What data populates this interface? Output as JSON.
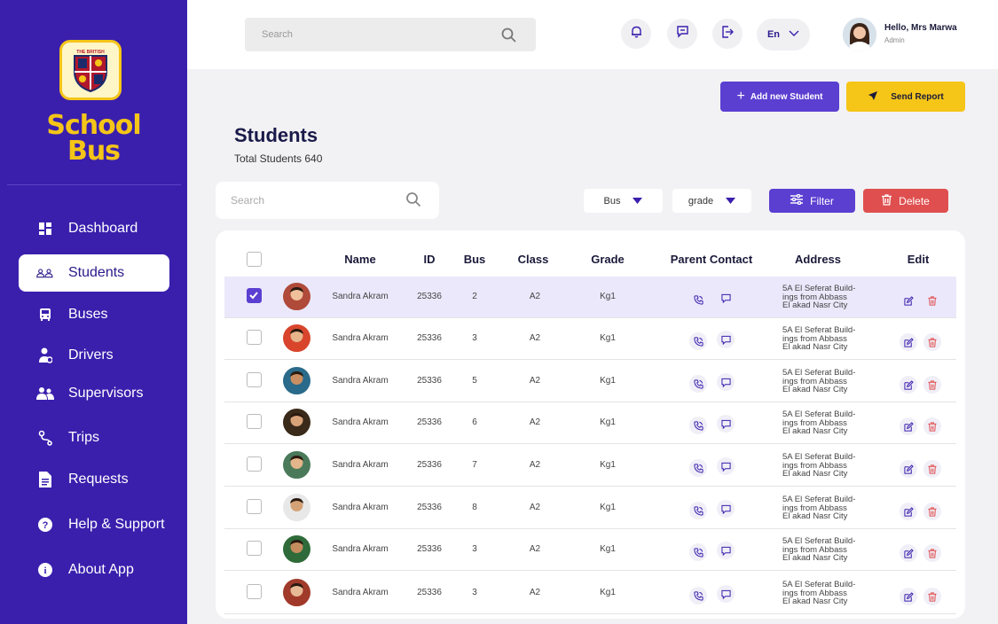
{
  "brand": {
    "line1": "School",
    "line2": "Bus",
    "badge_text": "THE BRITISH"
  },
  "nav": [
    {
      "label": "Dashboard",
      "icon": "dashboard-icon"
    },
    {
      "label": "Students",
      "icon": "students-icon",
      "active": true
    },
    {
      "label": "Buses",
      "icon": "bus-icon"
    },
    {
      "label": "Drivers",
      "icon": "driver-icon"
    },
    {
      "label": "Supervisors",
      "icon": "supervisors-icon"
    },
    {
      "label": "Trips",
      "icon": "trips-icon"
    },
    {
      "label": "Requests",
      "icon": "document-icon"
    },
    {
      "label": "Help & Support",
      "icon": "help-icon"
    },
    {
      "label": "About App",
      "icon": "info-icon"
    }
  ],
  "topbar": {
    "search_placeholder": "Search",
    "language": "En",
    "greeting": "Hello, Mrs Marwa",
    "role": "Admin"
  },
  "actions": {
    "add_student": "Add new Student",
    "send_report": "Send Report"
  },
  "page": {
    "title": "Students",
    "subtitle": "Total Students 640"
  },
  "toolbar": {
    "search_placeholder": "Search",
    "bus_select": "Bus",
    "grade_select": "grade",
    "filter": "Filter",
    "delete": "Delete"
  },
  "table": {
    "headers": {
      "name": "Name",
      "id": "ID",
      "bus": "Bus",
      "class": "Class",
      "grade": "Grade",
      "parent_contact": "Parent Contact",
      "address": "Address",
      "edit": "Edit"
    },
    "rows": [
      {
        "name": "Sandra Akram",
        "id": "25336",
        "bus": "2",
        "class": "A2",
        "grade": "Kg1",
        "address": [
          "5A El Seferat Build-",
          "ings from Abbass",
          "El akad Nasr City"
        ],
        "checked": true
      },
      {
        "name": "Sandra Akram",
        "id": "25336",
        "bus": "3",
        "class": "A2",
        "grade": "Kg1",
        "address": [
          "5A El Seferat Build-",
          "ings from Abbass",
          "El akad Nasr City"
        ],
        "checked": false
      },
      {
        "name": "Sandra Akram",
        "id": "25336",
        "bus": "5",
        "class": "A2",
        "grade": "Kg1",
        "address": [
          "5A El Seferat Build-",
          "ings from Abbass",
          "El akad Nasr City"
        ],
        "checked": false
      },
      {
        "name": "Sandra Akram",
        "id": "25336",
        "bus": "6",
        "class": "A2",
        "grade": "Kg1",
        "address": [
          "5A El Seferat Build-",
          "ings from Abbass",
          "El akad Nasr City"
        ],
        "checked": false
      },
      {
        "name": "Sandra Akram",
        "id": "25336",
        "bus": "7",
        "class": "A2",
        "grade": "Kg1",
        "address": [
          "5A El Seferat Build-",
          "ings from Abbass",
          "El akad Nasr City"
        ],
        "checked": false
      },
      {
        "name": "Sandra Akram",
        "id": "25336",
        "bus": "8",
        "class": "A2",
        "grade": "Kg1",
        "address": [
          "5A El Seferat Build-",
          "ings from Abbass",
          "El akad Nasr City"
        ],
        "checked": false
      },
      {
        "name": "Sandra Akram",
        "id": "25336",
        "bus": "3",
        "class": "A2",
        "grade": "Kg1",
        "address": [
          "5A El Seferat Build-",
          "ings from Abbass",
          "El akad Nasr City"
        ],
        "checked": false
      },
      {
        "name": "Sandra Akram",
        "id": "25336",
        "bus": "3",
        "class": "A2",
        "grade": "Kg1",
        "address": [
          "5A El Seferat Build-",
          "ings from Abbass",
          "El akad Nasr City"
        ],
        "checked": false
      }
    ]
  },
  "colors": {
    "primary": "#3a1fad",
    "accent": "#5b3fd1",
    "yellow": "#f5c518",
    "danger": "#e04f4f"
  }
}
